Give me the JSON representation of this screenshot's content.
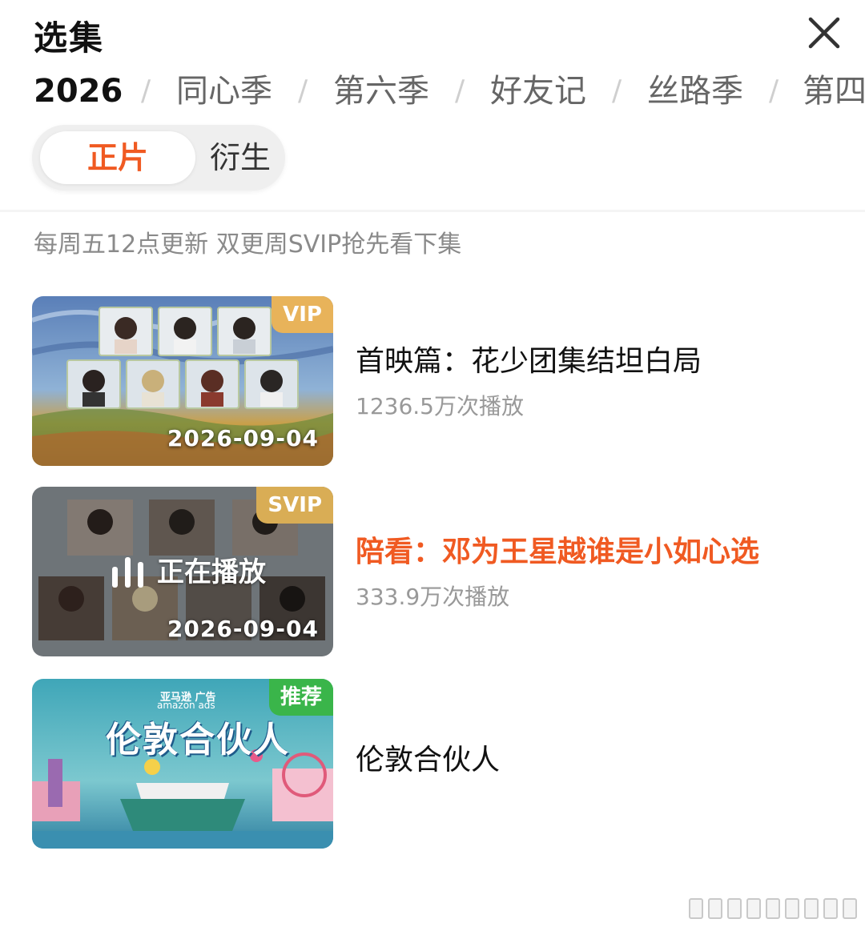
{
  "header": {
    "title": "选集",
    "close_icon": "close-icon"
  },
  "seasons": [
    "2026",
    "同心季",
    "第六季",
    "好友记",
    "丝路季",
    "第四"
  ],
  "season_separator": "/",
  "active_season_index": 0,
  "type_toggle": {
    "options": [
      "正片",
      "衍生"
    ],
    "active": "正片"
  },
  "update_note": "每周五12点更新 双更周SVIP抢先看下集",
  "episodes": [
    {
      "title": "首映篇：花少团集结坦白局",
      "views": "1236.5万次播放",
      "badge": "VIP",
      "date": "2026-09-04",
      "playing": false
    },
    {
      "title": "陪看：邓为王星越谁是小如心选",
      "views": "333.9万次播放",
      "badge": "SVIP",
      "date": "2026-09-04",
      "playing": true,
      "playing_label": "正在播放"
    },
    {
      "title": "伦敦合伙人",
      "views": "",
      "badge": "推荐",
      "date": "",
      "playing": false,
      "thumb_text": "伦敦合伙人",
      "thumb_ad": "亚马逊 广告",
      "thumb_brand": "amazon ads"
    }
  ],
  "colors": {
    "accent": "#f05a22",
    "vip_badge": "#e8b35a",
    "recommend_badge": "#3ab54a",
    "muted": "#999999"
  }
}
